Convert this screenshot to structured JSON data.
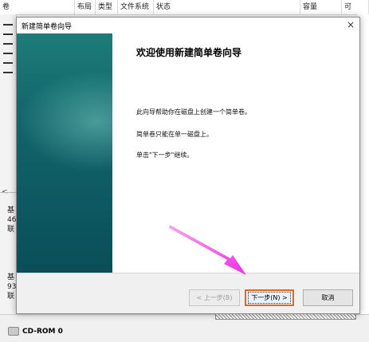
{
  "background": {
    "columns": [
      "卷",
      "布局",
      "类型",
      "文件系统",
      "状态",
      "容量",
      "可"
    ],
    "scroll_left_glyph": "<",
    "disk1_lines": [
      "基",
      "46",
      "联"
    ],
    "disk2_lines": [
      "基",
      "93",
      "联"
    ],
    "cdrom_label": "CD-ROM 0"
  },
  "dialog": {
    "title": "新建简单卷向导",
    "close_glyph": "×",
    "heading": "欢迎使用新建简单卷向导",
    "paragraphs": [
      "此向导帮助你在磁盘上创建一个简单卷。",
      "简单卷只能在单一磁盘上。",
      "单击\"下一步\"继续。"
    ],
    "buttons": {
      "back": "< 上一步(B)",
      "next": "下一步(N) >",
      "cancel": "取消"
    }
  },
  "colors": {
    "panel_teal": "#12656a",
    "next_highlight": "#e06a19",
    "arrow_magenta": "#f23ee6"
  }
}
